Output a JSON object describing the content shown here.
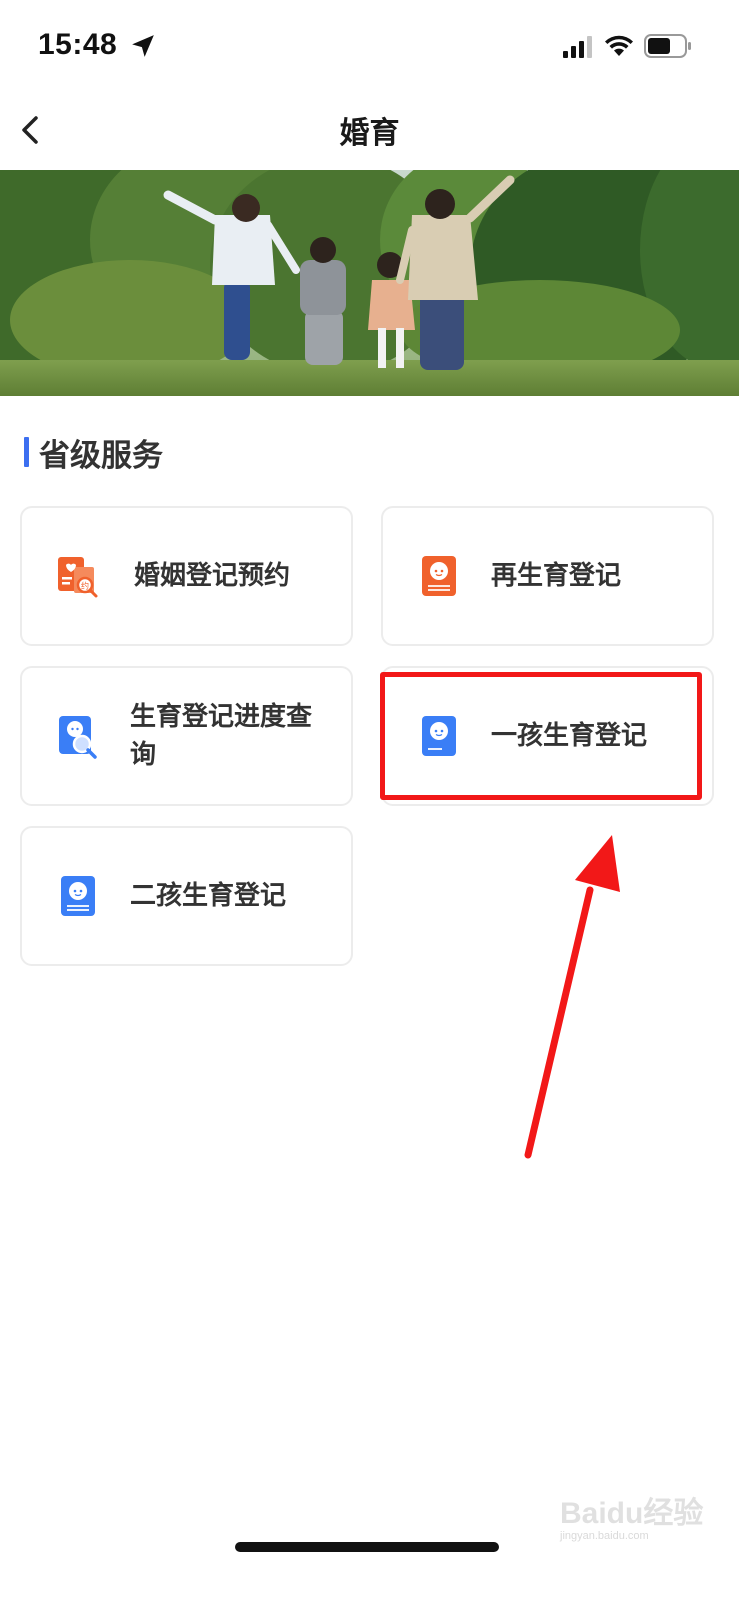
{
  "status_bar": {
    "time": "15:48",
    "icons": [
      "location-arrow-icon",
      "signal-icon",
      "wifi-icon",
      "battery-icon"
    ]
  },
  "nav": {
    "title": "婚育",
    "back_icon": "chevron-left-icon"
  },
  "banner": {
    "image": "family-running-on-grass-photo"
  },
  "section": {
    "title": "省级服务",
    "accent_color": "#3c6ff0"
  },
  "services": [
    {
      "label": "婚姻登记预约",
      "icon": "marriage-appointment-icon",
      "icon_color": "#f0612c"
    },
    {
      "label": "再生育登记",
      "icon": "baby-book-icon",
      "icon_color": "#f0612c"
    },
    {
      "label": "生育登记进度查询",
      "icon": "baby-search-icon",
      "icon_color": "#3a7ef6"
    },
    {
      "label": "一孩生育登记",
      "icon": "baby-book-icon",
      "icon_color": "#3a7ef6"
    },
    {
      "label": "二孩生育登记",
      "icon": "baby-book-icon",
      "icon_color": "#3a7ef6"
    }
  ],
  "annotation": {
    "highlight_color": "#f21818"
  },
  "watermark": {
    "text": "Baidu经验",
    "url": "jingyan.baidu.com"
  }
}
